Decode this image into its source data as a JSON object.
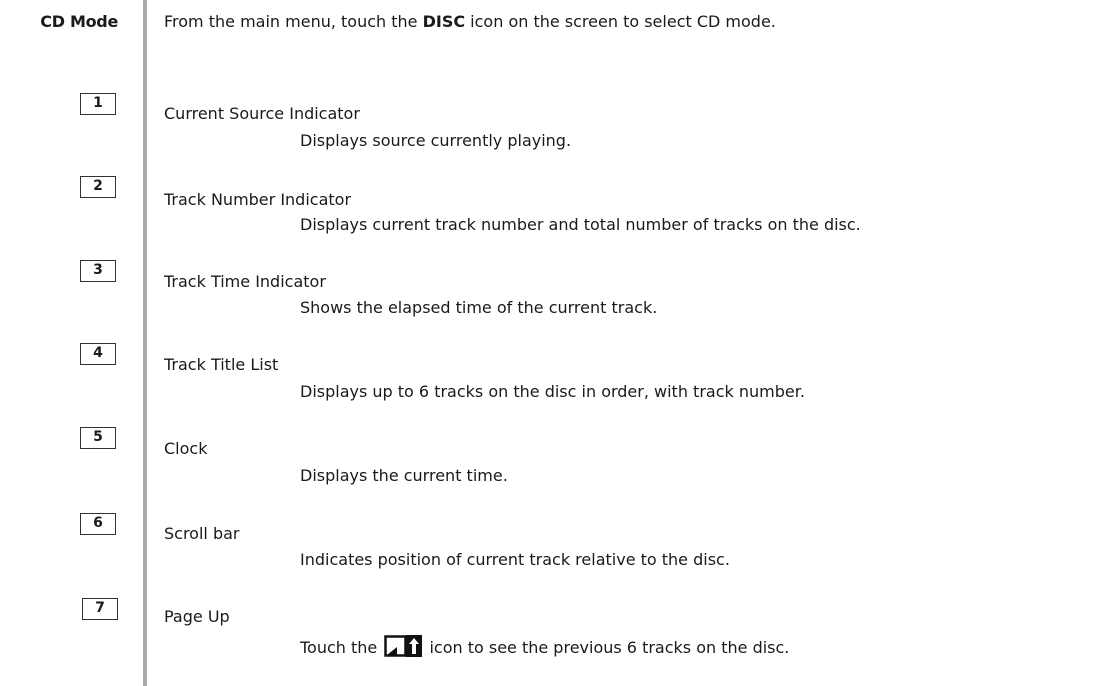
{
  "section": {
    "label": "CD Mode"
  },
  "intro": {
    "before": "From the main menu, touch the ",
    "bold": "DISC",
    "after": " icon on the screen to select CD mode."
  },
  "items": [
    {
      "number": "1",
      "term": "Current Source Indicator",
      "description": "Displays source currently playing."
    },
    {
      "number": "2",
      "term": "Track Number Indicator",
      "description": "Displays current track number and total number of tracks on the disc."
    },
    {
      "number": "3",
      "term": "Track Time Indicator",
      "description": "Shows the elapsed time of the current track."
    },
    {
      "number": "4",
      "term": "Track Title List",
      "description": "Displays up to 6 tracks on the disc in order, with track number."
    },
    {
      "number": "5",
      "term": "Clock",
      "description": "Displays the current time."
    },
    {
      "number": "6",
      "term": "Scroll bar",
      "description": "Indicates position of current track relative to the disc."
    },
    {
      "number": "7",
      "term": "Page Up",
      "description_before": "Touch the ",
      "description_icon": "page-up-icon",
      "description_after": " icon to see the previous 6 tracks on the disc."
    }
  ]
}
